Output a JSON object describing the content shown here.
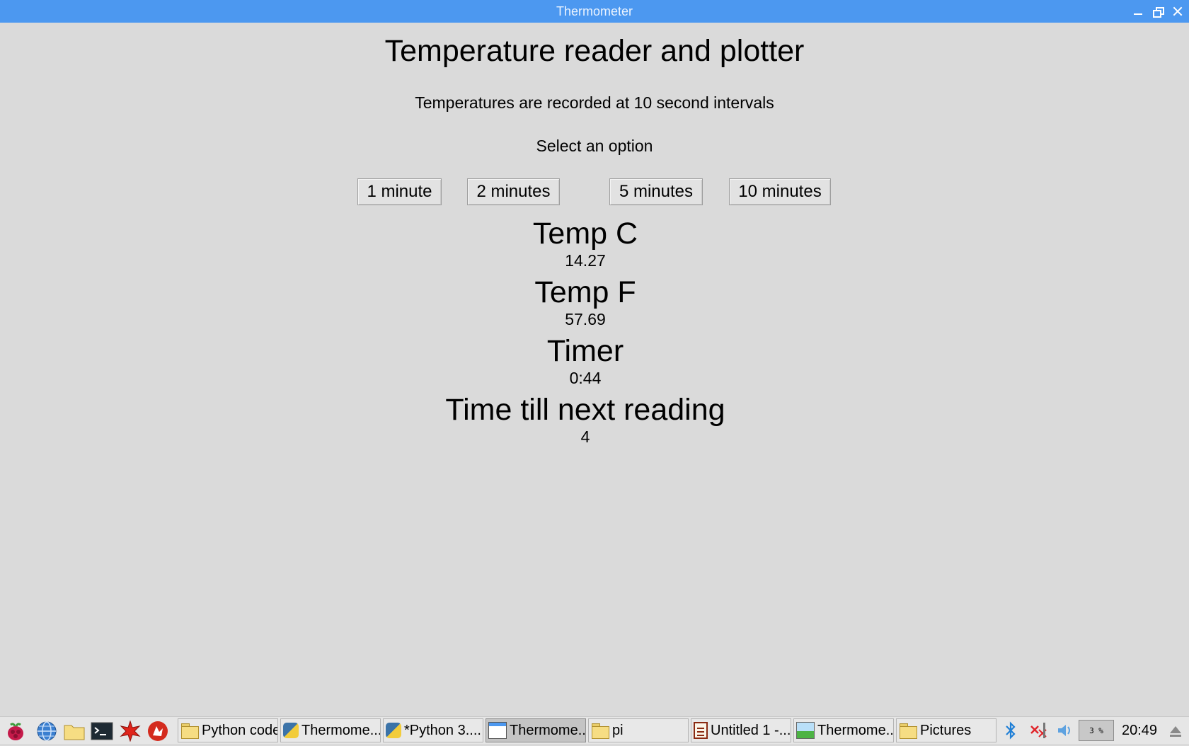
{
  "window": {
    "title": "Thermometer",
    "controls": {
      "minimize_icon": "minimize-icon",
      "maximize_icon": "restore-icon",
      "close_icon": "close-icon"
    }
  },
  "app": {
    "heading": "Temperature reader and plotter",
    "subtitle": "Temperatures are recorded at 10 second intervals",
    "select_label": "Select an option",
    "options": [
      {
        "label": "1 minute"
      },
      {
        "label": "2 minutes"
      },
      {
        "label": "5 minutes"
      },
      {
        "label": "10 minutes"
      }
    ],
    "readouts": [
      {
        "label": "Temp C",
        "value": "14.27"
      },
      {
        "label": "Temp F",
        "value": "57.69"
      },
      {
        "label": "Timer",
        "value": "0:44"
      },
      {
        "label": "Time till next reading",
        "value": "4"
      }
    ]
  },
  "taskbar": {
    "launchers": [
      "raspberry-menu-icon",
      "web-browser-icon",
      "file-manager-icon",
      "terminal-icon",
      "mathematica-icon",
      "wolfram-icon"
    ],
    "tasks": [
      {
        "label": "Python code",
        "icon": "folder-icon"
      },
      {
        "label": "Thermome...",
        "icon": "python-icon"
      },
      {
        "label": "*Python 3....",
        "icon": "python-icon"
      },
      {
        "label": "Thermome...",
        "icon": "window-icon",
        "active": true
      },
      {
        "label": "pi",
        "icon": "folder-icon"
      },
      {
        "label": "Untitled 1 -...",
        "icon": "document-icon"
      },
      {
        "label": "Thermome...",
        "icon": "image-viewer-icon"
      },
      {
        "label": "Pictures",
        "icon": "folder-icon"
      }
    ],
    "tray": {
      "icons": [
        "bluetooth-icon",
        "network-disconnected-icon",
        "volume-icon"
      ],
      "cpu_usage": "3 %",
      "clock": "20:49",
      "eject_icon": "eject-icon"
    },
    "colors": {
      "accent": "#4c98f0",
      "background": "#dadada"
    }
  }
}
